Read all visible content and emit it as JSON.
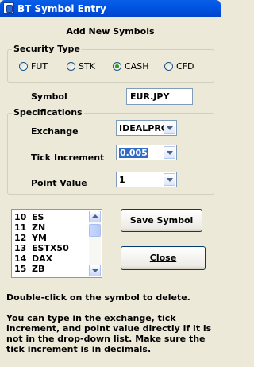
{
  "window": {
    "title": "BT Symbol Entry",
    "caption": "Add New Symbols"
  },
  "security_type": {
    "legend": "Security Type",
    "options": [
      {
        "label": "FUT",
        "selected": false
      },
      {
        "label": "STK",
        "selected": false
      },
      {
        "label": "CASH",
        "selected": true
      },
      {
        "label": "CFD",
        "selected": false
      }
    ]
  },
  "symbol": {
    "label": "Symbol",
    "value": "EUR.JPY"
  },
  "specifications": {
    "legend": "Specifications",
    "exchange": {
      "label": "Exchange",
      "value": "IDEALPRO"
    },
    "tick_increment": {
      "label": "Tick Increment",
      "value": "0.005"
    },
    "point_value": {
      "label": "Point Value",
      "value": "1"
    }
  },
  "symbol_list": [
    {
      "num": "10",
      "symbol": "ES"
    },
    {
      "num": "11",
      "symbol": "ZN"
    },
    {
      "num": "12",
      "symbol": "YM"
    },
    {
      "num": "13",
      "symbol": "ESTX50"
    },
    {
      "num": "14",
      "symbol": "DAX"
    },
    {
      "num": "15",
      "symbol": "ZB"
    }
  ],
  "buttons": {
    "save": "Save Symbol",
    "close": "Close"
  },
  "help": {
    "line1": "Double-click on the symbol to delete.",
    "line2": "You can type in the exchange, tick increment, and point value directly if it is not in the drop-down list.  Make sure the tick increment is in decimals."
  }
}
